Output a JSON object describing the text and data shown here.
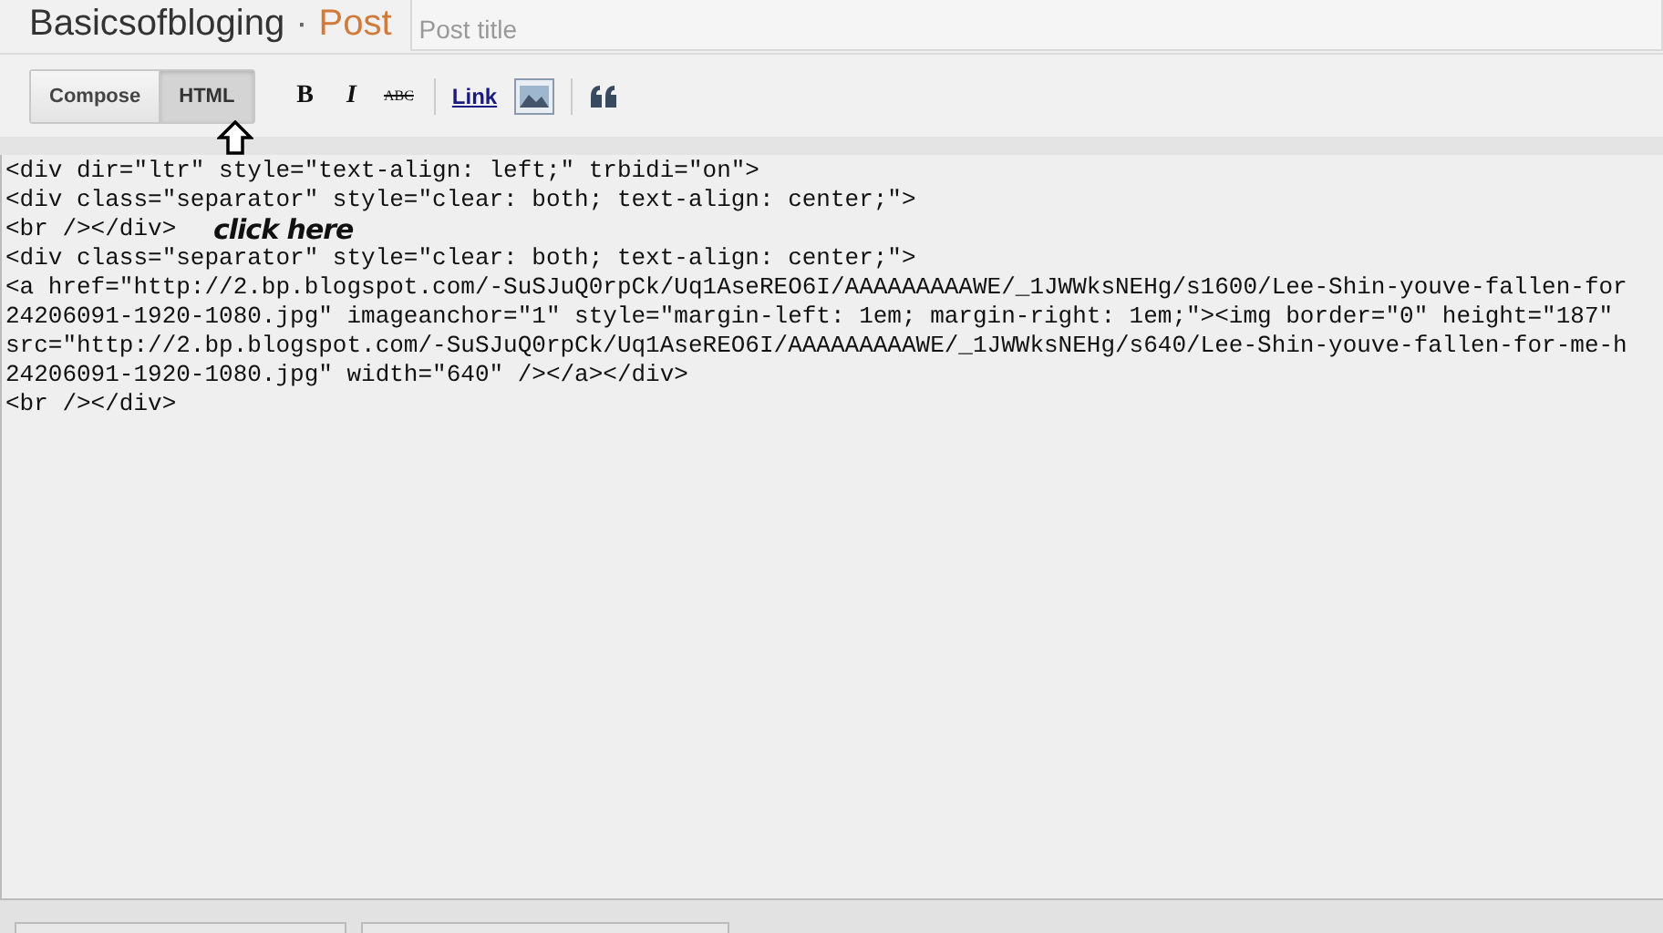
{
  "header": {
    "blog_name": "Basicsofbloging",
    "separator": "·",
    "page": "Post",
    "title_field": {
      "placeholder": "Post title"
    }
  },
  "mode_tabs": [
    {
      "label": "Compose",
      "selected": false
    },
    {
      "label": "HTML",
      "selected": true
    }
  ],
  "toolbar": [
    {
      "kind": "bold",
      "label": "B"
    },
    {
      "kind": "italic",
      "label": "I"
    },
    {
      "kind": "strike",
      "label": "ABC"
    },
    {
      "kind": "separator"
    },
    {
      "kind": "link",
      "label": "Link"
    },
    {
      "kind": "image"
    },
    {
      "kind": "separator"
    },
    {
      "kind": "quote"
    }
  ],
  "editor": {
    "lines": [
      "<div dir=\"ltr\" style=\"text-align: left;\" trbidi=\"on\">",
      "<div class=\"separator\" style=\"clear: both; text-align: center;\">",
      "<br /></div>",
      "<div class=\"separator\" style=\"clear: both; text-align: center;\">",
      "<a href=\"http://2.bp.blogspot.com/-SuSJuQ0rpCk/Uq1AseREO6I/AAAAAAAAAWE/_1JWWksNEHg/s1600/Lee-Shin-youve-fallen-for",
      "24206091-1920-1080.jpg\" imageanchor=\"1\" style=\"margin-left: 1em; margin-right: 1em;\"><img border=\"0\" height=\"187\"",
      "src=\"http://2.bp.blogspot.com/-SuSJuQ0rpCk/Uq1AseREO6I/AAAAAAAAAWE/_1JWWksNEHg/s640/Lee-Shin-youve-fallen-for-me-h",
      "24206091-1920-1080.jpg\" width=\"640\" /></a></div>",
      "<br /></div>"
    ]
  },
  "annotation": {
    "label": "click here"
  }
}
